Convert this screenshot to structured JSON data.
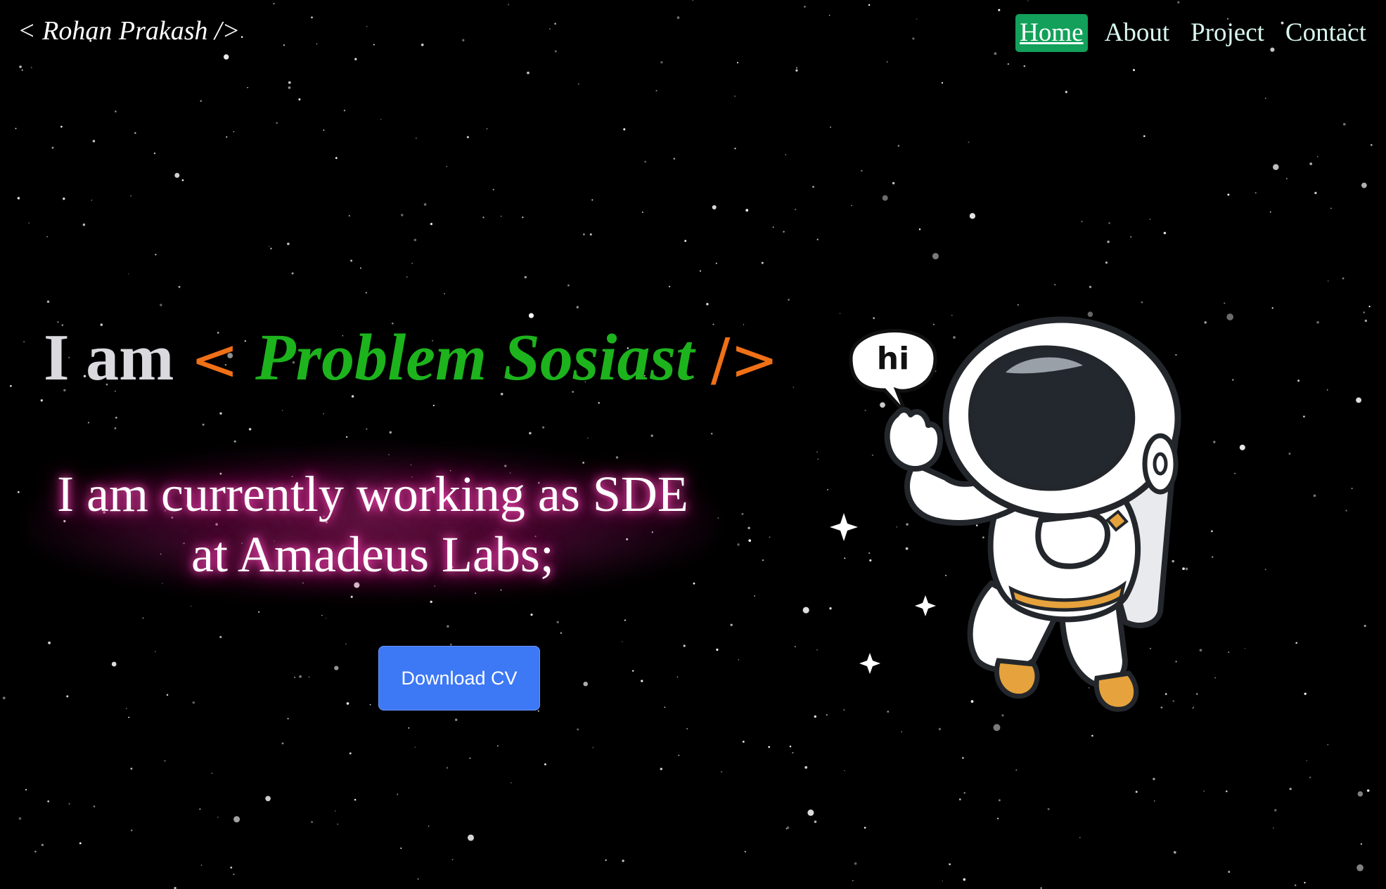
{
  "header": {
    "logo": "< Rohan Prakash />",
    "nav": [
      {
        "label": "Home",
        "active": true
      },
      {
        "label": "About",
        "active": false
      },
      {
        "label": "Project",
        "active": false
      },
      {
        "label": "Contact",
        "active": false
      }
    ]
  },
  "hero": {
    "prefix": "I am",
    "bracket_open": "<",
    "role": "Problem Sosiast",
    "bracket_close": "/>",
    "subtitle_line1": "I am currently working as SDE",
    "subtitle_line2": "at Amadeus Labs;",
    "download_button": "Download CV"
  },
  "illustration": {
    "speech_bubble": "hi",
    "icon": "astronaut-waving"
  },
  "colors": {
    "background": "#000000",
    "nav_active": "#12a05a",
    "role_green": "#1db31d",
    "bracket_orange": "#f07016",
    "button_blue": "#3d78f5",
    "glow_pink": "#c2207a"
  }
}
